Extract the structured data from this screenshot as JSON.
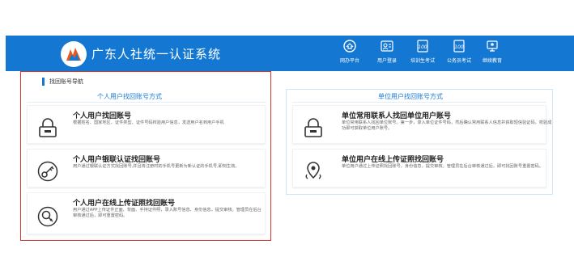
{
  "header": {
    "site_title": "广东人社统一认证系统",
    "nav": [
      {
        "label": "网办平台",
        "icon": "home-icon"
      },
      {
        "label": "用户登录",
        "icon": "user-login-icon"
      },
      {
        "label": "培训生考试",
        "icon": "exam-icon"
      },
      {
        "label": "公务员考试",
        "icon": "exam-icon"
      },
      {
        "label": "继续教育",
        "icon": "education-icon"
      }
    ]
  },
  "breadcrumb": "找回账号导航",
  "personal": {
    "title": "个人用户找回账号方式",
    "cards": [
      {
        "title": "个人用户找回账号",
        "desc": "根据姓名、国家地区、证件类型、证件号码校验用户信息，发送用户名到用户手机",
        "icon": "lock-icon"
      },
      {
        "title": "个人用户银联认证找回账号",
        "desc": "用户通过银联认证方式找回账号,并且将注册时的手机号更新为新认证的手机号,即刻生效。",
        "icon": "key-icon"
      },
      {
        "title": "个人用户在线上传证照找回账号",
        "desc": "用户通过APP上传证件正面、背面、手持证件照，录入账号信息、身份信息，提交审核。管理员在后台审核通过后，即可重置密码。",
        "icon": "search-key-icon"
      }
    ]
  },
  "unit": {
    "title": "单位用户找回账号方式",
    "cards": [
      {
        "title": "单位常用联系人找回单位用户账号",
        "desc": "单位常用联系人找回单位账号。第一步，录入单位证件号码，然后确认常用联系人信息并获取短信验证码，校验成功即可获取单位用户账号。",
        "icon": "lock-icon"
      },
      {
        "title": "单位用户在线上传证照找回账号",
        "desc": "单位用户通过上传证照找回账号，身份信息，提交审核。管理员在后台审核通过后，即可找回账号重置密码。",
        "icon": "location-key-icon"
      }
    ]
  },
  "colors": {
    "brand": "#1478d2",
    "highlight": "#d9332c"
  }
}
